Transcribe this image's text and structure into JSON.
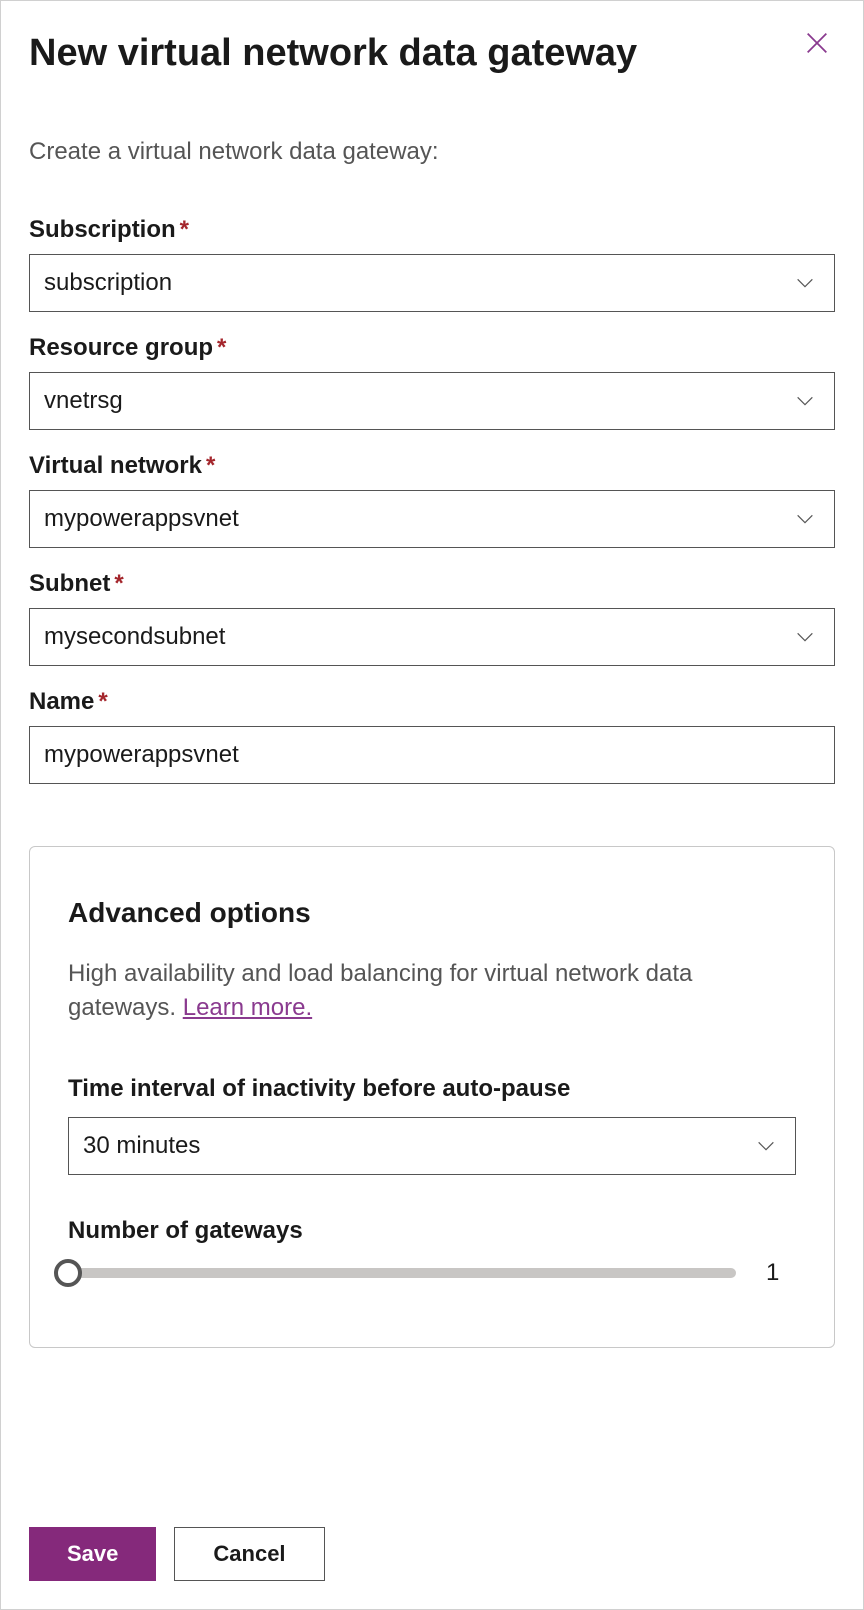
{
  "header": {
    "title": "New virtual network data gateway"
  },
  "subtitle": "Create a virtual network data gateway:",
  "fields": {
    "subscription": {
      "label": "Subscription",
      "value": "subscription"
    },
    "resource_group": {
      "label": "Resource group",
      "value": "vnetrsg"
    },
    "virtual_network": {
      "label": "Virtual network",
      "value": "mypowerappsvnet"
    },
    "subnet": {
      "label": "Subnet",
      "value": "mysecondsubnet"
    },
    "name": {
      "label": "Name",
      "value": "mypowerappsvnet"
    }
  },
  "advanced": {
    "title": "Advanced options",
    "description": "High availability and load balancing for virtual network data gateways. ",
    "learn_more": "Learn more.",
    "inactivity": {
      "label": "Time interval of inactivity before auto-pause",
      "value": "30 minutes"
    },
    "gateways": {
      "label": "Number of gateways",
      "value": "1"
    }
  },
  "footer": {
    "save": "Save",
    "cancel": "Cancel"
  },
  "required_mark": "*"
}
